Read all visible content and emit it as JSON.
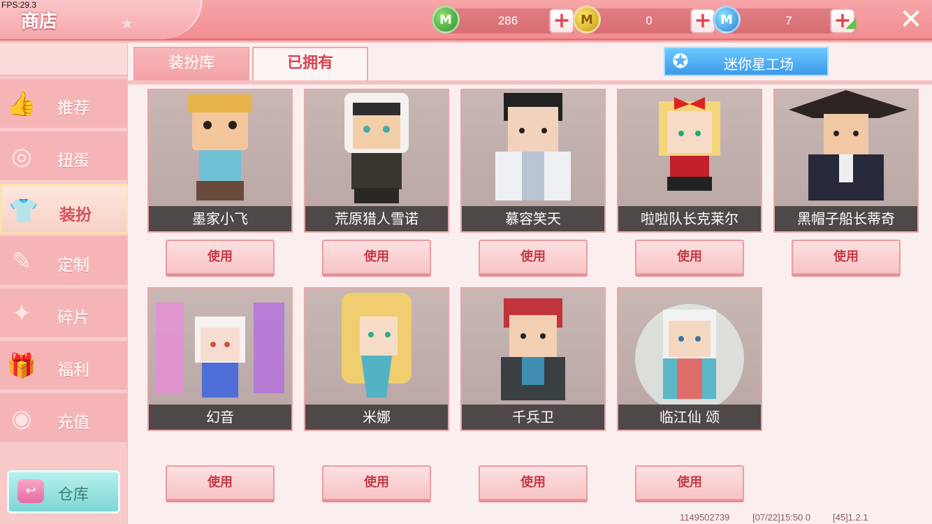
{
  "fps": "FPS:29.3",
  "title": "商店",
  "currencies": [
    {
      "icon": "green-m-coin-icon",
      "amount": "286"
    },
    {
      "icon": "gold-m-coin-icon",
      "amount": "0"
    },
    {
      "icon": "blue-m-coin-icon",
      "amount": "7"
    }
  ],
  "sidebar": {
    "items": [
      {
        "label": "推荐",
        "icon": "thumbs-up-icon"
      },
      {
        "label": "扭蛋",
        "icon": "capsule-icon"
      },
      {
        "label": "装扮",
        "icon": "shirt-icon"
      },
      {
        "label": "定制",
        "icon": "pencil-icon"
      },
      {
        "label": "碎片",
        "icon": "fragment-icon"
      },
      {
        "label": "福利",
        "icon": "gift-icon"
      },
      {
        "label": "充值",
        "icon": "coins-icon"
      }
    ],
    "warehouse_label": "仓库"
  },
  "tabs": [
    {
      "label": "装扮库"
    },
    {
      "label": "已拥有"
    }
  ],
  "factory_label": "迷你星工场",
  "skins": [
    {
      "name": "墨家小飞",
      "action": "使用"
    },
    {
      "name": "荒原猎人雪诺",
      "action": "使用"
    },
    {
      "name": "慕容笑天",
      "action": "使用"
    },
    {
      "name": "啦啦队长克莱尔",
      "action": "使用"
    },
    {
      "name": "黑帽子船长蒂奇",
      "action": "使用"
    },
    {
      "name": "幻音",
      "action": "使用"
    },
    {
      "name": "米娜",
      "action": "使用"
    },
    {
      "name": "千兵卫",
      "action": "使用"
    },
    {
      "name": "临江仙 颂",
      "action": "使用"
    }
  ],
  "footer": {
    "uid": "1149502739",
    "time": "[07/22]15:50 0",
    "version": "[45]1.2.1"
  },
  "colors": {
    "accent": "#f18e92",
    "button_text": "#c53a45"
  }
}
